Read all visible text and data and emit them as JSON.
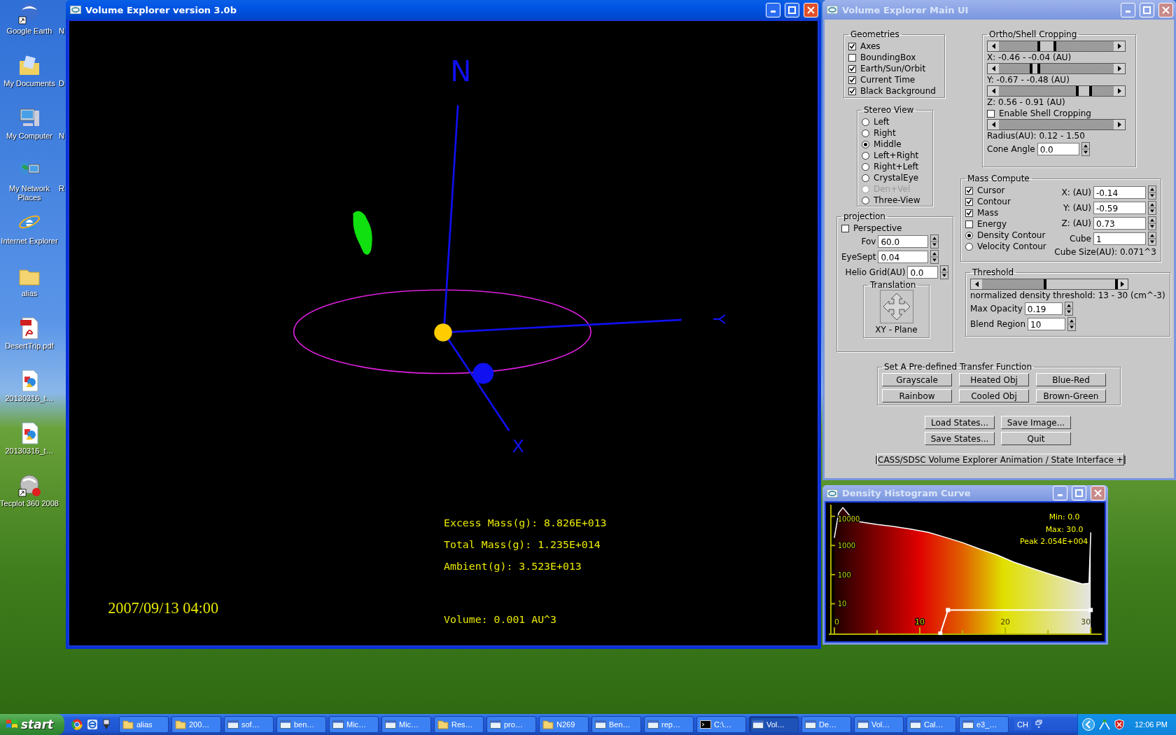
{
  "desktop": {
    "icons": [
      {
        "label": "Google Earth",
        "kind": "globe",
        "shortcut": true
      },
      {
        "label": "My Documents",
        "kind": "documents",
        "shortcut": false
      },
      {
        "label": "My Computer",
        "kind": "computer",
        "shortcut": false
      },
      {
        "label": "My Network Places",
        "kind": "network",
        "shortcut": false
      },
      {
        "label": "Internet Explorer",
        "kind": "browser",
        "shortcut": false
      },
      {
        "label": "alias",
        "kind": "folder",
        "shortcut": false
      },
      {
        "label": "DesertTrip.pdf",
        "kind": "pdf",
        "shortcut": false
      },
      {
        "label": "20130316_t…",
        "kind": "image",
        "shortcut": false
      },
      {
        "label": "20130316_t…",
        "kind": "image",
        "shortcut": false
      },
      {
        "label": "Tecplot 360 2008",
        "kind": "sphere",
        "shortcut": true
      }
    ],
    "clipped_labels": [
      "N",
      "D",
      "N",
      "R"
    ]
  },
  "viewer": {
    "title": "Volume Explorer version 3.0b",
    "active": true,
    "axis_labels": {
      "north": "N",
      "y": "Y",
      "x": "X"
    },
    "stats": [
      "Excess Mass(g): 8.826E+013",
      "Total Mass(g): 1.235E+014",
      "Ambient(g): 3.523E+013"
    ],
    "volume": "Volume: 0.001 AU^3",
    "timestamp": "2007/09/13 04:00"
  },
  "main_ui": {
    "title": "Volume Explorer Main UI",
    "active": false,
    "geometries": {
      "title": "Geometries",
      "items": [
        {
          "label": "Axes",
          "checked": true
        },
        {
          "label": "BoundingBox",
          "checked": false
        },
        {
          "label": "Earth/Sun/Orbit",
          "checked": true
        },
        {
          "label": "Current Time",
          "checked": true
        },
        {
          "label": "Black Background",
          "checked": true
        }
      ]
    },
    "stereo_view": {
      "title": "Stereo View",
      "options": [
        {
          "label": "Left",
          "selected": false,
          "disabled": false
        },
        {
          "label": "Right",
          "selected": false,
          "disabled": false
        },
        {
          "label": "Middle",
          "selected": true,
          "disabled": false
        },
        {
          "label": "Left+Right",
          "selected": false,
          "disabled": false
        },
        {
          "label": "Right+Left",
          "selected": false,
          "disabled": false
        },
        {
          "label": "CrystalEye",
          "selected": false,
          "disabled": false
        },
        {
          "label": "Den+Vel",
          "selected": false,
          "disabled": true
        },
        {
          "label": "Three-View",
          "selected": false,
          "disabled": false
        }
      ]
    },
    "projection": {
      "title": "projection",
      "perspective": {
        "label": "Perspective",
        "checked": false
      },
      "fields": [
        {
          "label": "Fov",
          "value": "60.0"
        },
        {
          "label": "EyeSept",
          "value": "0.04"
        },
        {
          "label": "Helio Grid(AU)",
          "value": "0.0"
        }
      ],
      "translation": {
        "title": "Translation",
        "caption": "XY - Plane"
      }
    },
    "cropping": {
      "title": "Ortho/Shell Cropping",
      "sliders": [
        {
          "handles": [
            {
              "level": 0.35
            },
            {
              "level": 0.49
            }
          ],
          "caption": "X: -0.46 - -0.04 (AU)"
        },
        {
          "handles": [
            {
              "level": 0.28
            },
            {
              "level": 0.35
            }
          ],
          "caption": "Y: -0.67 - -0.48 (AU)"
        },
        {
          "handles": [
            {
              "level": 0.68
            },
            {
              "level": 0.8
            }
          ],
          "caption": "Z: 0.56 - 0.91 (AU)"
        }
      ],
      "shell": {
        "label": "Enable Shell Cropping",
        "checked": false
      },
      "radius": "Radius(AU): 0.12 - 1.50",
      "cone_angle": {
        "label": "Cone Angle",
        "value": "0.0"
      }
    },
    "mass_compute": {
      "title": "Mass Compute",
      "options": [
        {
          "kind": "checkbox",
          "label": "Cursor",
          "checked": true
        },
        {
          "kind": "checkbox",
          "label": "Contour",
          "checked": true
        },
        {
          "kind": "checkbox",
          "label": "Mass",
          "checked": true
        },
        {
          "kind": "checkbox",
          "label": "Energy",
          "checked": false
        },
        {
          "kind": "radio",
          "label": "Density Contour",
          "checked": true
        },
        {
          "kind": "radio",
          "label": "Velocity Contour",
          "checked": false
        }
      ],
      "fields": [
        {
          "label": "X: (AU)",
          "value": "-0.14"
        },
        {
          "label": "Y: (AU)",
          "value": "-0.59"
        },
        {
          "label": "Z: (AU)",
          "value": "0.73"
        },
        {
          "label": "Cube",
          "value": "1"
        }
      ],
      "cube_size": "Cube Size(AU): 0.071^3"
    },
    "threshold": {
      "title": "Threshold",
      "handles": [
        {
          "level": 0.47
        },
        {
          "level": 1.0
        }
      ],
      "caption": "normalized density threshold: 13 - 30 (cm^-3)",
      "fields": [
        {
          "label": "Max Opacity",
          "value": "0.19"
        },
        {
          "label": "Blend Region",
          "value": "10"
        }
      ]
    },
    "transfer_function": {
      "title": "Set A Pre-defined Transfer Function",
      "buttons": [
        "Grayscale",
        "Heated Obj",
        "Blue-Red",
        "Rainbow",
        "Cooled Obj",
        "Brown-Green"
      ]
    },
    "buttons": [
      "Load States...",
      "Save Image...",
      "Save States...",
      "Quit"
    ],
    "animation_bar": "CASS/SDSC Volume Explorer Animation / State Interface +"
  },
  "histogram": {
    "title": "Density Histogram Curve",
    "active": false,
    "min": "Min: 0.0",
    "max": "Max: 30.0",
    "peak": "Peak 2.054E+004",
    "y_tick_labels": [
      "10000",
      "1000",
      "100",
      "10"
    ],
    "x_tick_labels": [
      "0",
      "10",
      "20",
      "30"
    ]
  },
  "taskbar": {
    "start": "start",
    "tasks": [
      {
        "label": "alias",
        "kind": "folder",
        "selected": false
      },
      {
        "label": "200…",
        "kind": "folder",
        "selected": false
      },
      {
        "label": "sof…",
        "kind": "app",
        "selected": false
      },
      {
        "label": "ben…",
        "kind": "app",
        "selected": false
      },
      {
        "label": "Mic…",
        "kind": "app",
        "selected": false
      },
      {
        "label": "Mic…",
        "kind": "app",
        "selected": false
      },
      {
        "label": "Res…",
        "kind": "folder",
        "selected": false
      },
      {
        "label": "pro…",
        "kind": "app",
        "selected": false
      },
      {
        "label": "N269",
        "kind": "folder",
        "selected": false
      },
      {
        "label": "Ben…",
        "kind": "app",
        "selected": false
      },
      {
        "label": "rep…",
        "kind": "app",
        "selected": false
      },
      {
        "label": "C:\\…",
        "kind": "console",
        "selected": false
      },
      {
        "label": "Vol…",
        "kind": "app",
        "selected": true
      },
      {
        "label": "De…",
        "kind": "app",
        "selected": false
      },
      {
        "label": "Vol…",
        "kind": "app",
        "selected": false
      },
      {
        "label": "Cal…",
        "kind": "app",
        "selected": false
      },
      {
        "label": "e3_…",
        "kind": "app",
        "selected": false
      }
    ],
    "language": "CH",
    "clock": "12:06 PM"
  }
}
